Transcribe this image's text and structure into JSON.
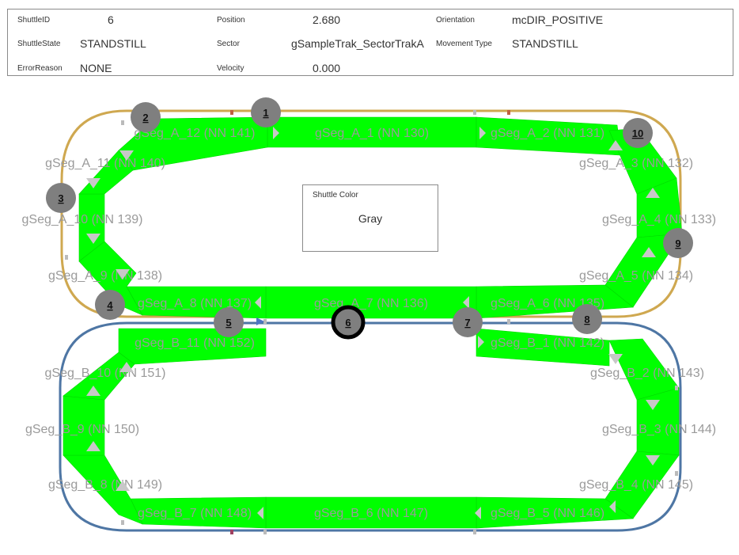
{
  "info": {
    "shuttle_id_label": "ShuttleID",
    "shuttle_id": "6",
    "state_label": "ShuttleState",
    "state": "STANDSTILL",
    "error_label": "ErrorReason",
    "error": "NONE",
    "position_label": "Position",
    "position": "2.680",
    "sector_label": "Sector",
    "sector": "gSampleTrak_SectorTrakA",
    "velocity_label": "Velocity",
    "velocity": "0.000",
    "orientation_label": "Orientation",
    "orientation": "mcDIR_POSITIVE",
    "movement_label": "Movement Type",
    "movement": "STANDSTILL"
  },
  "shuttle_color": {
    "label": "Shuttle Color",
    "value": "Gray"
  },
  "colors": {
    "segment_fill": "#00ff00",
    "outer_a_rail": "#cfa850",
    "outer_b_rail": "#4e76a4",
    "shuttle_fill": "#7f7f7f",
    "selected_border": "#000000",
    "label_gray": "#9a9a9a"
  },
  "segments": [
    "gSeg_A_1 (NN 130)",
    "gSeg_A_2 (NN 131)",
    "gSeg_A_3 (NN 132)",
    "gSeg_A_4 (NN 133)",
    "gSeg_A_5 (NN 134)",
    "gSeg_A_6 (NN 135)",
    "gSeg_A_7 (NN 136)",
    "gSeg_A_8 (NN 137)",
    "gSeg_A_9 (NN 138)",
    "gSeg_A_10 (NN 139)",
    "gSeg_A_11 (NN 140)",
    "gSeg_A_12 (NN 141)",
    "gSeg_B_1 (NN 142)",
    "gSeg_B_2 (NN 143)",
    "gSeg_B_3 (NN 144)",
    "gSeg_B_4 (NN 145)",
    "gSeg_B_5 (NN 146)",
    "gSeg_B_6 (NN 147)",
    "gSeg_B_7 (NN 148)",
    "gSeg_B_8 (NN 149)",
    "gSeg_B_9 (NN 150)",
    "gSeg_B_10 (NN 151)",
    "gSeg_B_11 (NN 152)"
  ],
  "shuttles": [
    "1",
    "2",
    "3",
    "4",
    "5",
    "6",
    "7",
    "8",
    "9",
    "10"
  ],
  "selected_shuttle": "6"
}
